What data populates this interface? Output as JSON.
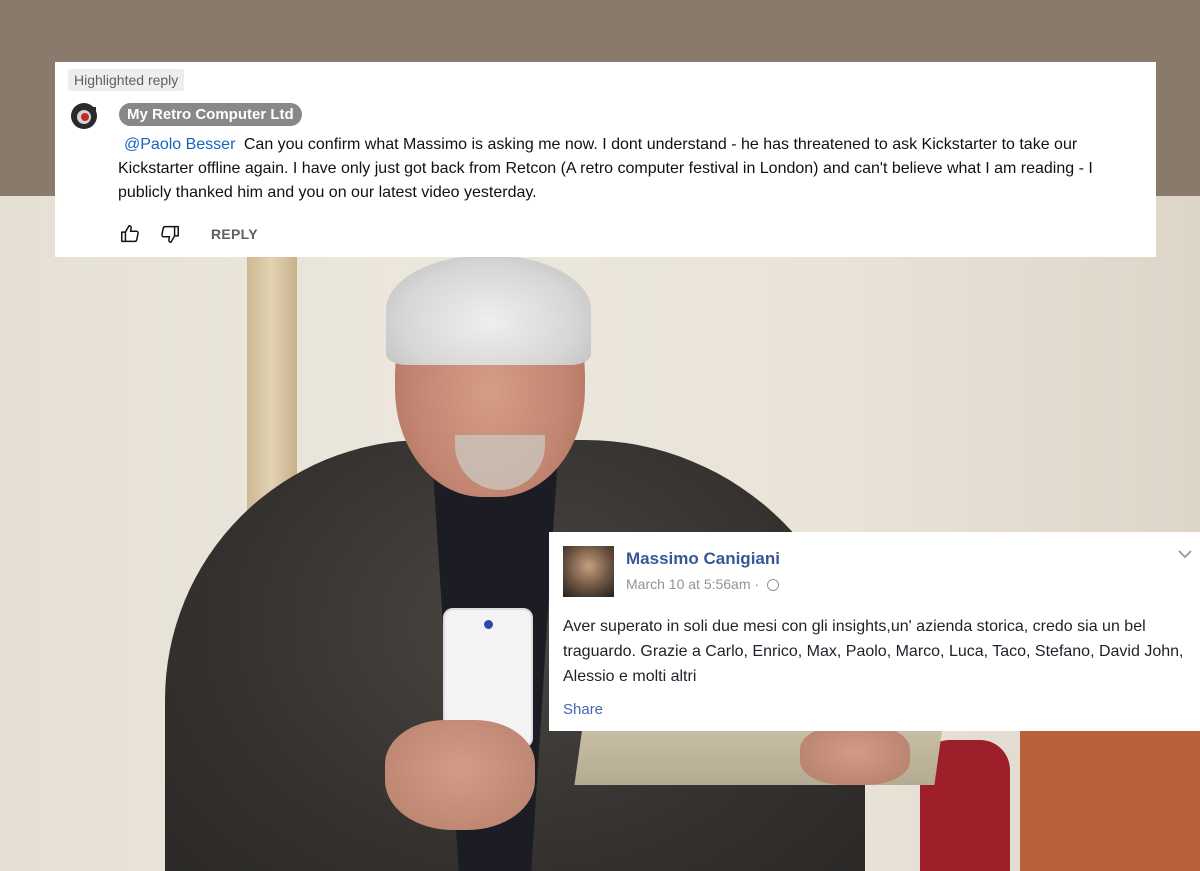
{
  "youtube_comment": {
    "badge": "Highlighted reply",
    "author": "My Retro Computer Ltd",
    "mention": "@Paolo Besser",
    "text": "Can you confirm what Massimo is asking me now. I dont understand - he has threatened to ask Kickstarter to take our Kickstarter offline again. I have only just got back from Retcon (A retro computer festival in London) and can't believe what I am reading - I publicly thanked him and you on our latest video yesterday.",
    "reply_label": "REPLY",
    "icons": {
      "like": "thumbs-up-icon",
      "dislike": "thumbs-down-icon",
      "avatar": "channel-avatar-icon"
    }
  },
  "facebook_post": {
    "author": "Massimo Canigiani",
    "timestamp": "March 10 at 5:56am",
    "separator": "·",
    "text": "Aver superato in soli due mesi con gli insights,un' azienda storica, credo sia un bel traguardo. Grazie a Carlo, Enrico, Max, Paolo, Marco, Luca, Taco, Stefano, David John, Alessio e molti altri",
    "share_label": "Share",
    "icons": {
      "privacy": "globe-icon",
      "menu": "chevron-down-icon"
    }
  },
  "colors": {
    "background_band": "#8a7a6c",
    "youtube_mention": "#1565c0",
    "facebook_name": "#365899",
    "facebook_share": "#4267b2"
  }
}
